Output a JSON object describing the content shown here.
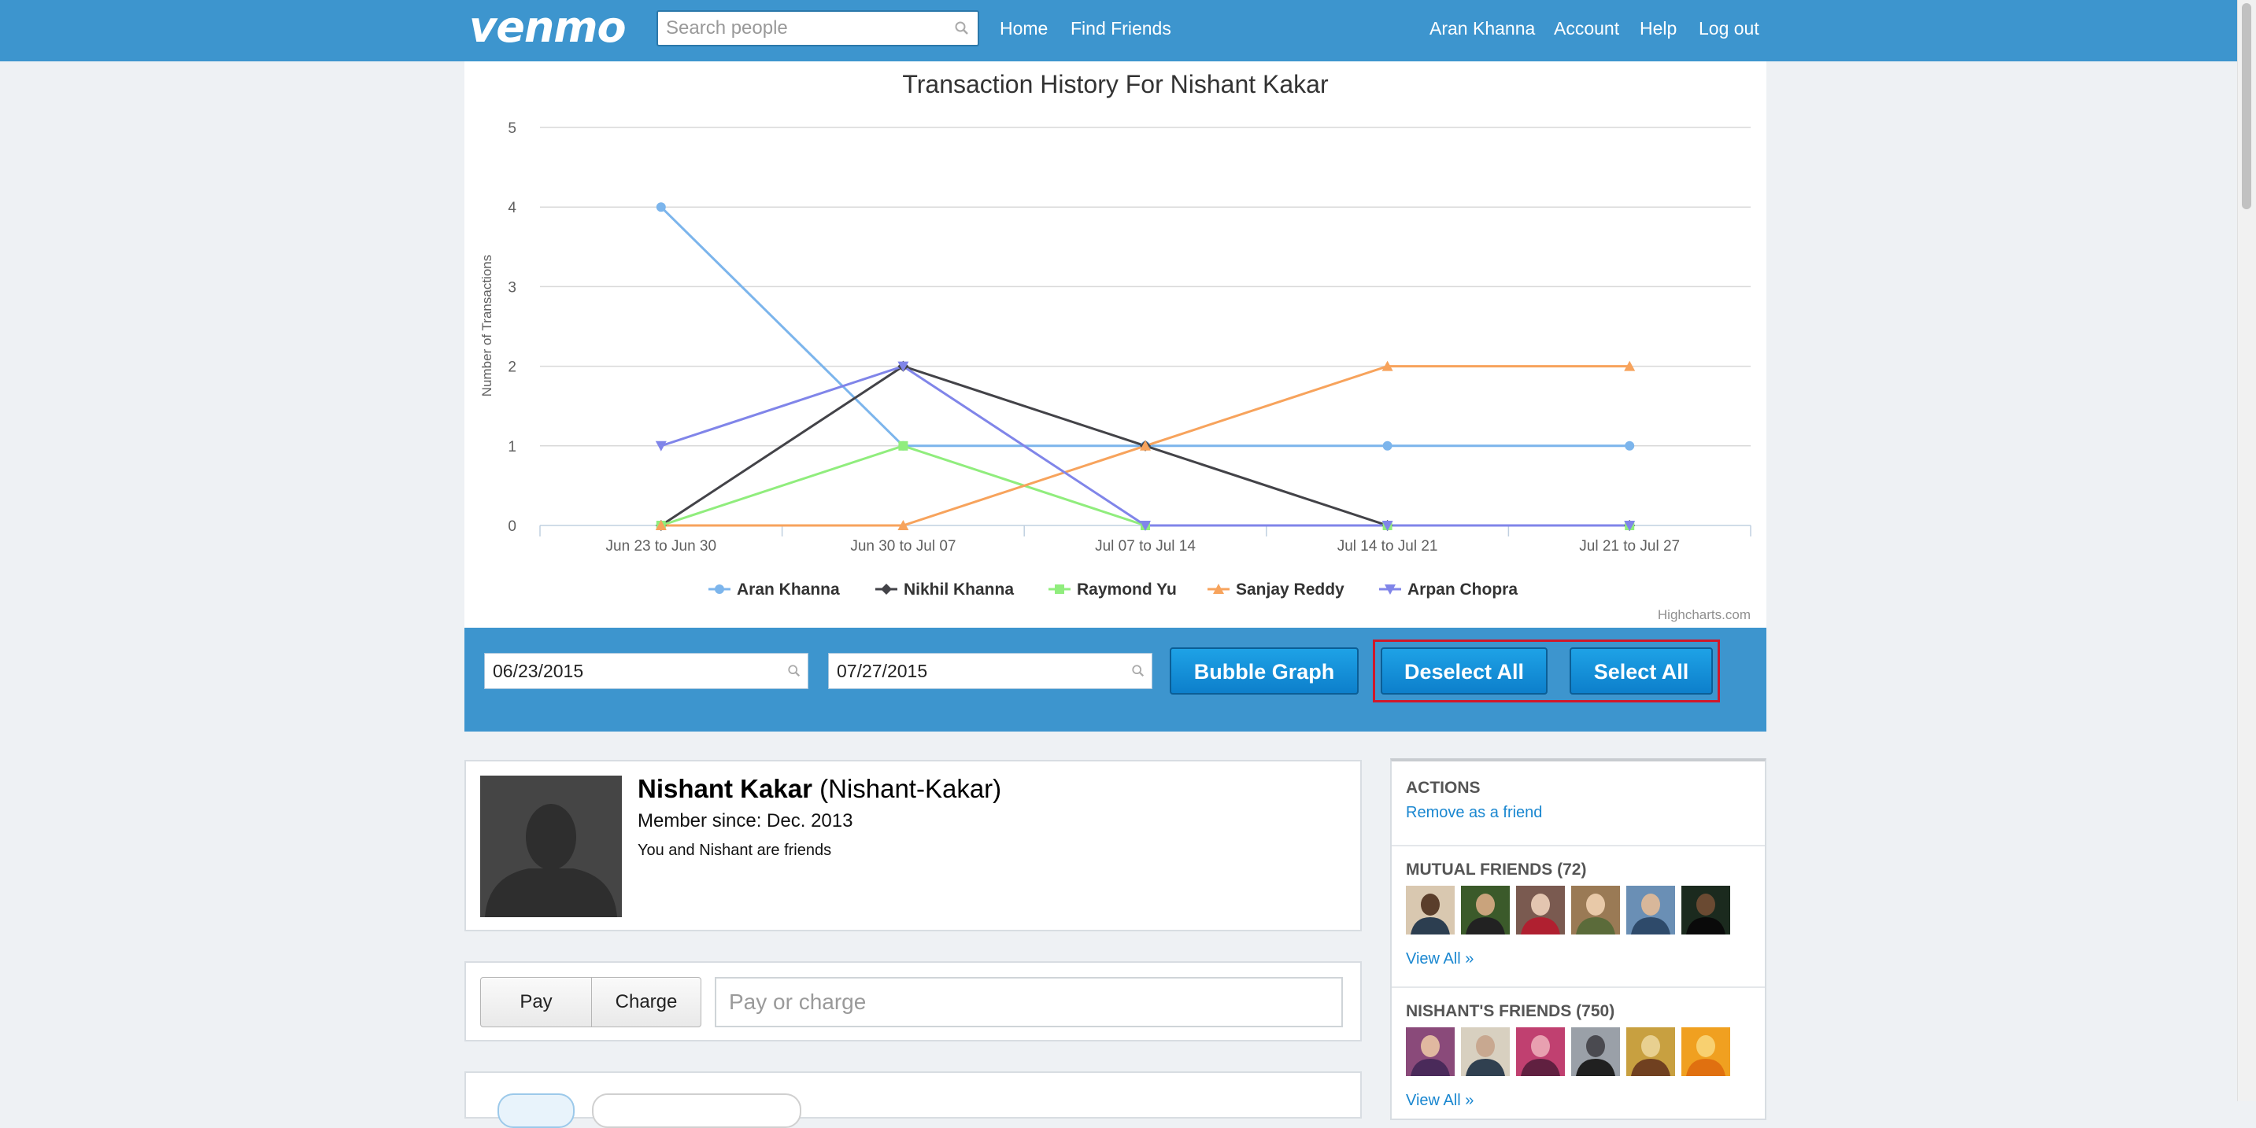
{
  "header": {
    "logo": "venmo",
    "search_placeholder": "Search people",
    "nav_left": [
      "Home",
      "Find Friends"
    ],
    "nav_right": [
      "Aran Khanna",
      "Account",
      "Help",
      "Log out"
    ]
  },
  "chart_data": {
    "type": "line",
    "title": "Transaction History For Nishant Kakar",
    "xlabel": "",
    "ylabel": "Number of Transactions",
    "categories": [
      "Jun 23 to Jun 30",
      "Jun 30 to Jul 07",
      "Jul 07 to Jul 14",
      "Jul 14 to Jul 21",
      "Jul 21 to Jul 27"
    ],
    "ylim": [
      0,
      5
    ],
    "yticks": [
      0,
      1,
      2,
      3,
      4,
      5
    ],
    "grid": true,
    "legend_position": "bottom-center",
    "series": [
      {
        "name": "Aran Khanna",
        "values": [
          4,
          1,
          1,
          1,
          1
        ],
        "color": "#7cb5ec",
        "marker": "circle"
      },
      {
        "name": "Nikhil Khanna",
        "values": [
          0,
          2,
          1,
          0,
          0
        ],
        "color": "#434348",
        "marker": "diamond"
      },
      {
        "name": "Raymond Yu",
        "values": [
          0,
          1,
          0,
          0,
          0
        ],
        "color": "#90ed7d",
        "marker": "square"
      },
      {
        "name": "Sanjay Reddy",
        "values": [
          0,
          0,
          1,
          2,
          2
        ],
        "color": "#f7a35c",
        "marker": "triangle"
      },
      {
        "name": "Arpan Chopra",
        "values": [
          1,
          2,
          0,
          0,
          0
        ],
        "color": "#8085e9",
        "marker": "triangle-down"
      }
    ],
    "credits": "Highcharts.com"
  },
  "controls": {
    "start_date": "06/23/2015",
    "end_date": "07/27/2015",
    "bubble_graph_label": "Bubble Graph",
    "deselect_all_label": "Deselect All",
    "select_all_label": "Select All",
    "highlight_color": "#d0182a"
  },
  "profile": {
    "name": "Nishant Kakar",
    "username": "(Nishant-Kakar)",
    "member_since": "Member since: Dec. 2013",
    "friendship": "You and Nishant are friends"
  },
  "pay": {
    "pay_label": "Pay",
    "charge_label": "Charge",
    "placeholder": "Pay or charge"
  },
  "sidebar": {
    "actions_heading": "ACTIONS",
    "remove_friend": "Remove as a friend",
    "mutual_heading": "MUTUAL FRIENDS (72)",
    "view_all_mutual": "View All »",
    "friends_heading": "NISHANT'S FRIENDS (750)",
    "view_all_friends": "View All »"
  },
  "colors": {
    "brand_blue": "#3d95ce",
    "button_blue": "#1592dc",
    "link_blue": "#1a87d0"
  }
}
